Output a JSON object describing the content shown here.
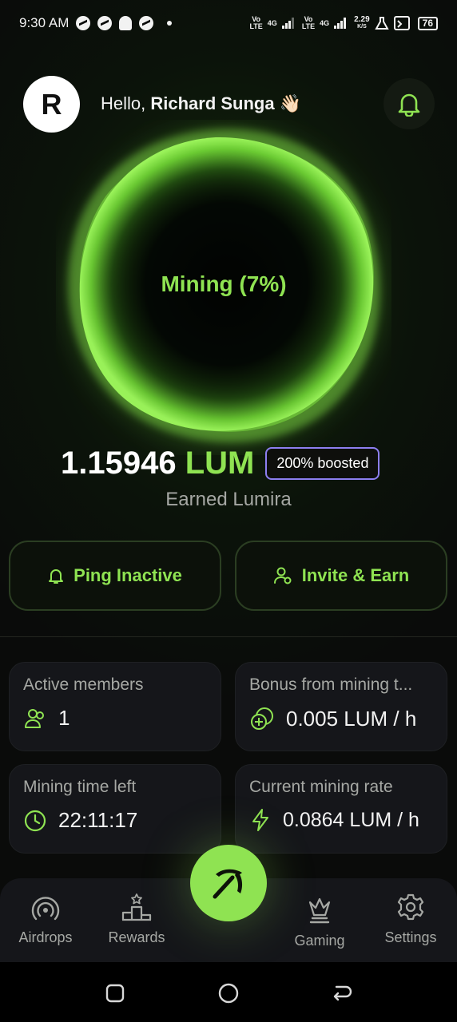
{
  "status_bar": {
    "time": "9:30 AM",
    "net_tag_1": [
      "Vo",
      "LTE"
    ],
    "net_gen_1": "4G",
    "net_tag_2": [
      "Vo",
      "LTE"
    ],
    "net_gen_2": "4G",
    "speed_value": "2.29",
    "speed_unit": "K/S",
    "battery": "76"
  },
  "header": {
    "avatar_initial": "R",
    "greeting_prefix": "Hello, ",
    "user_name": "Richard Sunga",
    "greeting_emoji": "👋🏻"
  },
  "mining": {
    "status_label": "Mining (7%)",
    "progress_percent": 7,
    "balance_value": "1.15946",
    "balance_unit": "LUM",
    "boost_badge": "200% boosted",
    "earned_label": "Earned Lumira"
  },
  "actions": {
    "ping_label": "Ping Inactive",
    "invite_label": "Invite & Earn"
  },
  "stats": {
    "active_members": {
      "title": "Active members",
      "value": "1"
    },
    "bonus": {
      "title": "Bonus from mining t...",
      "value": "0.005 LUM / h"
    },
    "time_left": {
      "title": "Mining time left",
      "value": "22:11:17"
    },
    "rate": {
      "title": "Current mining rate",
      "value": "0.0864 LUM / h"
    }
  },
  "bottom_nav": {
    "airdrops": "Airdrops",
    "rewards": "Rewards",
    "gaming": "Gaming",
    "settings": "Settings"
  },
  "colors": {
    "accent": "#8fe352",
    "badge_border": "#8d7ff0",
    "card_bg": "#15161a"
  },
  "icons": {
    "avatar": "avatar-initial",
    "bell": "bell-icon",
    "ping": "bell-small-icon",
    "invite": "user-plus-icon",
    "members": "users-icon",
    "bonus": "coins-icon",
    "time": "clock-icon",
    "rate": "lightning-icon",
    "airdrops": "broadcast-icon",
    "rewards": "podium-icon",
    "fab": "pickaxe-icon",
    "gaming": "chess-queen-icon",
    "settings": "gear-icon"
  }
}
